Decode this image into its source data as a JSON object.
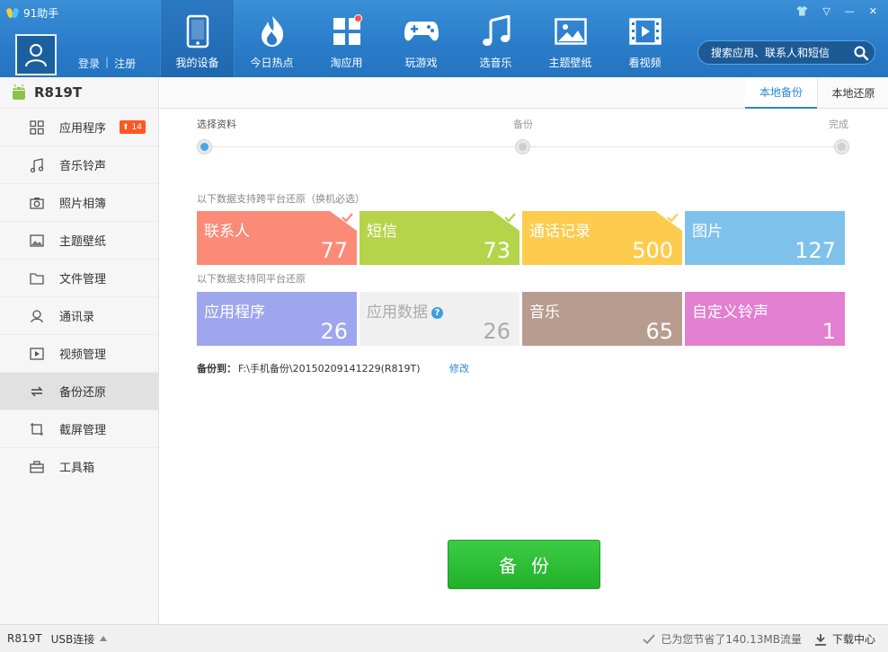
{
  "app": {
    "title": "91助手"
  },
  "window_controls": {
    "skin": "👕",
    "menu": "▽",
    "minimize": "—",
    "close": "✕"
  },
  "account": {
    "login": "登录",
    "separator": "|",
    "register": "注册"
  },
  "nav": {
    "items": [
      {
        "label": "我的设备",
        "icon": "phone-icon",
        "active": true
      },
      {
        "label": "今日热点",
        "icon": "flame-icon"
      },
      {
        "label": "淘应用",
        "icon": "apps-icon",
        "dot": true
      },
      {
        "label": "玩游戏",
        "icon": "gamepad-icon"
      },
      {
        "label": "选音乐",
        "icon": "music-note-icon"
      },
      {
        "label": "主题壁纸",
        "icon": "picture-icon"
      },
      {
        "label": "看视频",
        "icon": "film-icon"
      }
    ]
  },
  "search": {
    "placeholder": "搜索应用、联系人和短信"
  },
  "device": {
    "name": "R819T"
  },
  "sidebar": {
    "items": [
      {
        "label": "应用程序",
        "icon": "grid-icon",
        "badge": "14"
      },
      {
        "label": "音乐铃声",
        "icon": "music-icon"
      },
      {
        "label": "照片相簿",
        "icon": "camera-icon"
      },
      {
        "label": "主题壁纸",
        "icon": "wallpaper-icon"
      },
      {
        "label": "文件管理",
        "icon": "folder-icon"
      },
      {
        "label": "通讯录",
        "icon": "contact-icon"
      },
      {
        "label": "视频管理",
        "icon": "video-icon"
      },
      {
        "label": "备份还原",
        "icon": "sync-icon",
        "active": true
      },
      {
        "label": "截屏管理",
        "icon": "screenshot-icon"
      },
      {
        "label": "工具箱",
        "icon": "toolbox-icon"
      }
    ]
  },
  "tabs": {
    "backup": "本地备份",
    "restore": "本地还原"
  },
  "steps": {
    "select": "选择资料",
    "backup": "备份",
    "done": "完成"
  },
  "notes": {
    "cross_platform": "以下数据支持跨平台还原（换机必选）",
    "same_platform": "以下数据支持同平台还原"
  },
  "tiles": {
    "cross": [
      {
        "name": "联系人",
        "count": "77",
        "color": "#fb8a77",
        "checked": true
      },
      {
        "name": "短信",
        "count": "73",
        "color": "#b5d44a",
        "checked": true
      },
      {
        "name": "通话记录",
        "count": "500",
        "color": "#fdcc4e",
        "checked": true
      },
      {
        "name": "图片",
        "count": "127",
        "color": "#7ec2ec",
        "checked": false
      }
    ],
    "same": [
      {
        "name": "应用程序",
        "count": "26",
        "color": "#9ea6ee",
        "checked": false
      },
      {
        "name": "应用数据",
        "count": "26",
        "color": "#f0f0f0",
        "checked": false,
        "disabled": true,
        "help": "?"
      },
      {
        "name": "音乐",
        "count": "65",
        "color": "#b89c90",
        "checked": false
      },
      {
        "name": "自定义铃声",
        "count": "1",
        "color": "#e27fd1",
        "checked": false
      }
    ]
  },
  "backup": {
    "path_label": "备份到：",
    "path": "F:\\手机备份\\20150209141229(R819T)",
    "modify": "修改",
    "button": "备份"
  },
  "status": {
    "device": "R819T",
    "connection": "USB连接",
    "saved": "已为您节省了140.13MB流量",
    "download": "下载中心"
  }
}
